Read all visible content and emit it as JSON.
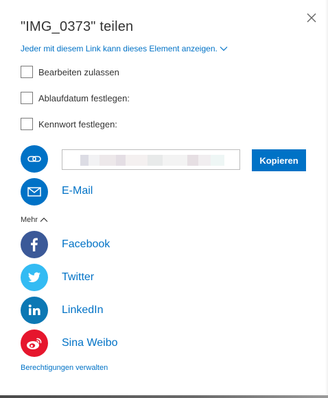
{
  "dialog": {
    "title": "\"IMG_0373\" teilen",
    "link_scope": "Jeder mit diesem Link kann dieses Element anzeigen.",
    "options": [
      {
        "label": "Bearbeiten zulassen",
        "checked": false
      },
      {
        "label": "Ablaufdatum festlegen:",
        "checked": false
      },
      {
        "label": "Kennwort festlegen:",
        "checked": false
      }
    ],
    "link": {
      "value": "",
      "copy_label": "Kopieren"
    },
    "email_label": "E-Mail",
    "more_label": "Mehr",
    "services": [
      {
        "label": "Facebook",
        "color": "#3b5998",
        "icon": "facebook-icon"
      },
      {
        "label": "Twitter",
        "color": "#33bbf3",
        "icon": "twitter-icon"
      },
      {
        "label": "LinkedIn",
        "color": "#0c78b4",
        "icon": "linkedin-icon"
      },
      {
        "label": "Sina Weibo",
        "color": "#e6162d",
        "icon": "weibo-icon"
      }
    ],
    "permissions_label": "Berechtigungen verwalten",
    "colors": {
      "accent": "#0072c6",
      "text": "#333333"
    }
  }
}
